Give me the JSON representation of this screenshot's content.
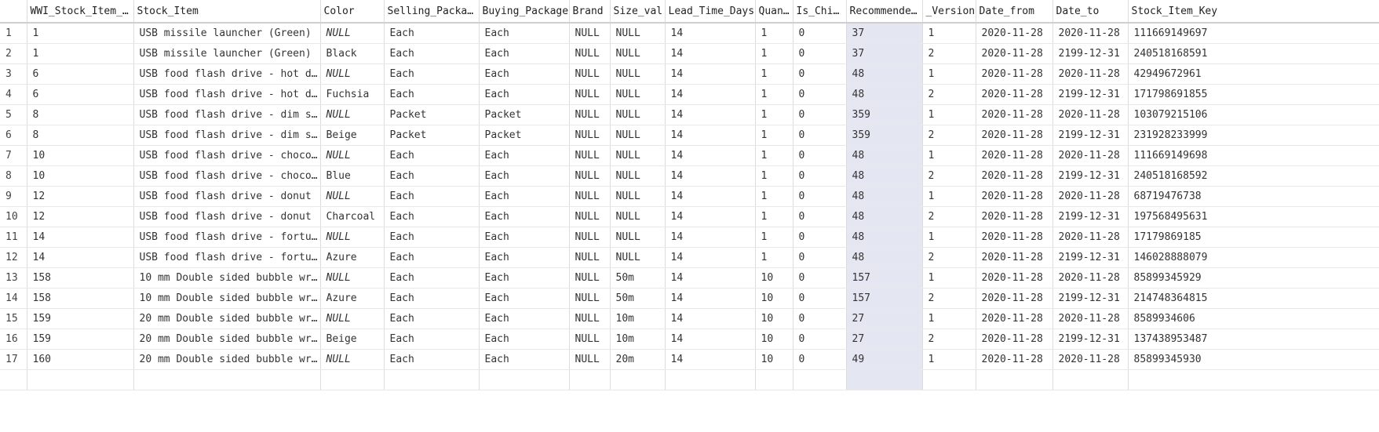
{
  "grid": {
    "columns": [
      {
        "key": "rownum",
        "label": ""
      },
      {
        "key": "WWI_Stock_Item_ID",
        "label": "WWI_Stock_Item_ID"
      },
      {
        "key": "Stock_Item",
        "label": "Stock_Item"
      },
      {
        "key": "Color",
        "label": "Color"
      },
      {
        "key": "Selling_Package",
        "label": "Selling_Package"
      },
      {
        "key": "Buying_Package",
        "label": "Buying_Package"
      },
      {
        "key": "Brand",
        "label": "Brand"
      },
      {
        "key": "Size_val",
        "label": "Size_val"
      },
      {
        "key": "Lead_Time_Days",
        "label": "Lead_Time_Days"
      },
      {
        "key": "Quantity",
        "label": "Quan…"
      },
      {
        "key": "Is_Chiller",
        "label": "Is_Chi…"
      },
      {
        "key": "Recommended",
        "label": "Recommende…"
      },
      {
        "key": "_Version",
        "label": "_Version"
      },
      {
        "key": "Date_from",
        "label": "Date_from"
      },
      {
        "key": "Date_to",
        "label": "Date_to"
      },
      {
        "key": "Stock_Item_Key",
        "label": "Stock_Item_Key"
      }
    ],
    "selected_column": "Recommended",
    "rows": [
      {
        "rownum": "1",
        "WWI_Stock_Item_ID": "1",
        "Stock_Item": "USB missile launcher (Green)",
        "Color": "NULL",
        "Color_italic": true,
        "Selling_Package": "Each",
        "Buying_Package": "Each",
        "Brand": "NULL",
        "Size_val": "NULL",
        "Lead_Time_Days": "14",
        "Quantity": "1",
        "Is_Chiller": "0",
        "Recommended": "37",
        "_Version": "1",
        "Date_from": "2020-11-28",
        "Date_to": "2020-11-28",
        "Stock_Item_Key": "111669149697"
      },
      {
        "rownum": "2",
        "WWI_Stock_Item_ID": "1",
        "Stock_Item": "USB missile launcher (Green)",
        "Color": "Black",
        "Color_italic": false,
        "Selling_Package": "Each",
        "Buying_Package": "Each",
        "Brand": "NULL",
        "Size_val": "NULL",
        "Lead_Time_Days": "14",
        "Quantity": "1",
        "Is_Chiller": "0",
        "Recommended": "37",
        "_Version": "2",
        "Date_from": "2020-11-28",
        "Date_to": "2199-12-31",
        "Stock_Item_Key": "240518168591"
      },
      {
        "rownum": "3",
        "WWI_Stock_Item_ID": "6",
        "Stock_Item": "USB food flash drive - hot d…",
        "Color": "NULL",
        "Color_italic": true,
        "Selling_Package": "Each",
        "Buying_Package": "Each",
        "Brand": "NULL",
        "Size_val": "NULL",
        "Lead_Time_Days": "14",
        "Quantity": "1",
        "Is_Chiller": "0",
        "Recommended": "48",
        "_Version": "1",
        "Date_from": "2020-11-28",
        "Date_to": "2020-11-28",
        "Stock_Item_Key": "42949672961"
      },
      {
        "rownum": "4",
        "WWI_Stock_Item_ID": "6",
        "Stock_Item": "USB food flash drive - hot d…",
        "Color": "Fuchsia",
        "Color_italic": false,
        "Selling_Package": "Each",
        "Buying_Package": "Each",
        "Brand": "NULL",
        "Size_val": "NULL",
        "Lead_Time_Days": "14",
        "Quantity": "1",
        "Is_Chiller": "0",
        "Recommended": "48",
        "_Version": "2",
        "Date_from": "2020-11-28",
        "Date_to": "2199-12-31",
        "Stock_Item_Key": "171798691855"
      },
      {
        "rownum": "5",
        "WWI_Stock_Item_ID": "8",
        "Stock_Item": "USB food flash drive - dim s…",
        "Color": "NULL",
        "Color_italic": true,
        "Selling_Package": "Packet",
        "Buying_Package": "Packet",
        "Brand": "NULL",
        "Size_val": "NULL",
        "Lead_Time_Days": "14",
        "Quantity": "1",
        "Is_Chiller": "0",
        "Recommended": "359",
        "_Version": "1",
        "Date_from": "2020-11-28",
        "Date_to": "2020-11-28",
        "Stock_Item_Key": "103079215106"
      },
      {
        "rownum": "6",
        "WWI_Stock_Item_ID": "8",
        "Stock_Item": "USB food flash drive - dim s…",
        "Color": "Beige",
        "Color_italic": false,
        "Selling_Package": "Packet",
        "Buying_Package": "Packet",
        "Brand": "NULL",
        "Size_val": "NULL",
        "Lead_Time_Days": "14",
        "Quantity": "1",
        "Is_Chiller": "0",
        "Recommended": "359",
        "_Version": "2",
        "Date_from": "2020-11-28",
        "Date_to": "2199-12-31",
        "Stock_Item_Key": "231928233999"
      },
      {
        "rownum": "7",
        "WWI_Stock_Item_ID": "10",
        "Stock_Item": "USB food flash drive - choco…",
        "Color": "NULL",
        "Color_italic": true,
        "Selling_Package": "Each",
        "Buying_Package": "Each",
        "Brand": "NULL",
        "Size_val": "NULL",
        "Lead_Time_Days": "14",
        "Quantity": "1",
        "Is_Chiller": "0",
        "Recommended": "48",
        "_Version": "1",
        "Date_from": "2020-11-28",
        "Date_to": "2020-11-28",
        "Stock_Item_Key": "111669149698"
      },
      {
        "rownum": "8",
        "WWI_Stock_Item_ID": "10",
        "Stock_Item": "USB food flash drive - choco…",
        "Color": "Blue",
        "Color_italic": false,
        "Selling_Package": "Each",
        "Buying_Package": "Each",
        "Brand": "NULL",
        "Size_val": "NULL",
        "Lead_Time_Days": "14",
        "Quantity": "1",
        "Is_Chiller": "0",
        "Recommended": "48",
        "_Version": "2",
        "Date_from": "2020-11-28",
        "Date_to": "2199-12-31",
        "Stock_Item_Key": "240518168592"
      },
      {
        "rownum": "9",
        "WWI_Stock_Item_ID": "12",
        "Stock_Item": "USB food flash drive - donut",
        "Color": "NULL",
        "Color_italic": true,
        "Selling_Package": "Each",
        "Buying_Package": "Each",
        "Brand": "NULL",
        "Size_val": "NULL",
        "Lead_Time_Days": "14",
        "Quantity": "1",
        "Is_Chiller": "0",
        "Recommended": "48",
        "_Version": "1",
        "Date_from": "2020-11-28",
        "Date_to": "2020-11-28",
        "Stock_Item_Key": "68719476738"
      },
      {
        "rownum": "10",
        "WWI_Stock_Item_ID": "12",
        "Stock_Item": "USB food flash drive - donut",
        "Color": "Charcoal",
        "Color_italic": false,
        "Selling_Package": "Each",
        "Buying_Package": "Each",
        "Brand": "NULL",
        "Size_val": "NULL",
        "Lead_Time_Days": "14",
        "Quantity": "1",
        "Is_Chiller": "0",
        "Recommended": "48",
        "_Version": "2",
        "Date_from": "2020-11-28",
        "Date_to": "2199-12-31",
        "Stock_Item_Key": "197568495631"
      },
      {
        "rownum": "11",
        "WWI_Stock_Item_ID": "14",
        "Stock_Item": "USB food flash drive - fortu…",
        "Color": "NULL",
        "Color_italic": true,
        "Selling_Package": "Each",
        "Buying_Package": "Each",
        "Brand": "NULL",
        "Size_val": "NULL",
        "Lead_Time_Days": "14",
        "Quantity": "1",
        "Is_Chiller": "0",
        "Recommended": "48",
        "_Version": "1",
        "Date_from": "2020-11-28",
        "Date_to": "2020-11-28",
        "Stock_Item_Key": "17179869185"
      },
      {
        "rownum": "12",
        "WWI_Stock_Item_ID": "14",
        "Stock_Item": "USB food flash drive - fortu…",
        "Color": "Azure",
        "Color_italic": false,
        "Selling_Package": "Each",
        "Buying_Package": "Each",
        "Brand": "NULL",
        "Size_val": "NULL",
        "Lead_Time_Days": "14",
        "Quantity": "1",
        "Is_Chiller": "0",
        "Recommended": "48",
        "_Version": "2",
        "Date_from": "2020-11-28",
        "Date_to": "2199-12-31",
        "Stock_Item_Key": "146028888079"
      },
      {
        "rownum": "13",
        "WWI_Stock_Item_ID": "158",
        "Stock_Item": "10 mm Double sided bubble wr…",
        "Color": "NULL",
        "Color_italic": true,
        "Selling_Package": "Each",
        "Buying_Package": "Each",
        "Brand": "NULL",
        "Size_val": "50m",
        "Lead_Time_Days": "14",
        "Quantity": "10",
        "Is_Chiller": "0",
        "Recommended": "157",
        "_Version": "1",
        "Date_from": "2020-11-28",
        "Date_to": "2020-11-28",
        "Stock_Item_Key": "85899345929"
      },
      {
        "rownum": "14",
        "WWI_Stock_Item_ID": "158",
        "Stock_Item": "10 mm Double sided bubble wr…",
        "Color": "Azure",
        "Color_italic": false,
        "Selling_Package": "Each",
        "Buying_Package": "Each",
        "Brand": "NULL",
        "Size_val": "50m",
        "Lead_Time_Days": "14",
        "Quantity": "10",
        "Is_Chiller": "0",
        "Recommended": "157",
        "_Version": "2",
        "Date_from": "2020-11-28",
        "Date_to": "2199-12-31",
        "Stock_Item_Key": "214748364815"
      },
      {
        "rownum": "15",
        "WWI_Stock_Item_ID": "159",
        "Stock_Item": "20 mm Double sided bubble wr…",
        "Color": "NULL",
        "Color_italic": true,
        "Selling_Package": "Each",
        "Buying_Package": "Each",
        "Brand": "NULL",
        "Size_val": "10m",
        "Lead_Time_Days": "14",
        "Quantity": "10",
        "Is_Chiller": "0",
        "Recommended": "27",
        "_Version": "1",
        "Date_from": "2020-11-28",
        "Date_to": "2020-11-28",
        "Stock_Item_Key": "8589934606"
      },
      {
        "rownum": "16",
        "WWI_Stock_Item_ID": "159",
        "Stock_Item": "20 mm Double sided bubble wr…",
        "Color": "Beige",
        "Color_italic": false,
        "Selling_Package": "Each",
        "Buying_Package": "Each",
        "Brand": "NULL",
        "Size_val": "10m",
        "Lead_Time_Days": "14",
        "Quantity": "10",
        "Is_Chiller": "0",
        "Recommended": "27",
        "_Version": "2",
        "Date_from": "2020-11-28",
        "Date_to": "2199-12-31",
        "Stock_Item_Key": "137438953487"
      },
      {
        "rownum": "17",
        "WWI_Stock_Item_ID": "160",
        "Stock_Item": "20 mm Double sided bubble wr…",
        "Color": "NULL",
        "Color_italic": true,
        "Selling_Package": "Each",
        "Buying_Package": "Each",
        "Brand": "NULL",
        "Size_val": "20m",
        "Lead_Time_Days": "14",
        "Quantity": "10",
        "Is_Chiller": "0",
        "Recommended": "49",
        "_Version": "1",
        "Date_from": "2020-11-28",
        "Date_to": "2020-11-28",
        "Stock_Item_Key": "85899345930"
      },
      {
        "rownum": "",
        "WWI_Stock_Item_ID": "",
        "Stock_Item": "",
        "Color": "",
        "Color_italic": false,
        "Selling_Package": "",
        "Buying_Package": "",
        "Brand": "",
        "Size_val": "",
        "Lead_Time_Days": "",
        "Quantity": "",
        "Is_Chiller": "",
        "Recommended": "",
        "_Version": "",
        "Date_from": "",
        "Date_to": "",
        "Stock_Item_Key": ""
      }
    ]
  }
}
